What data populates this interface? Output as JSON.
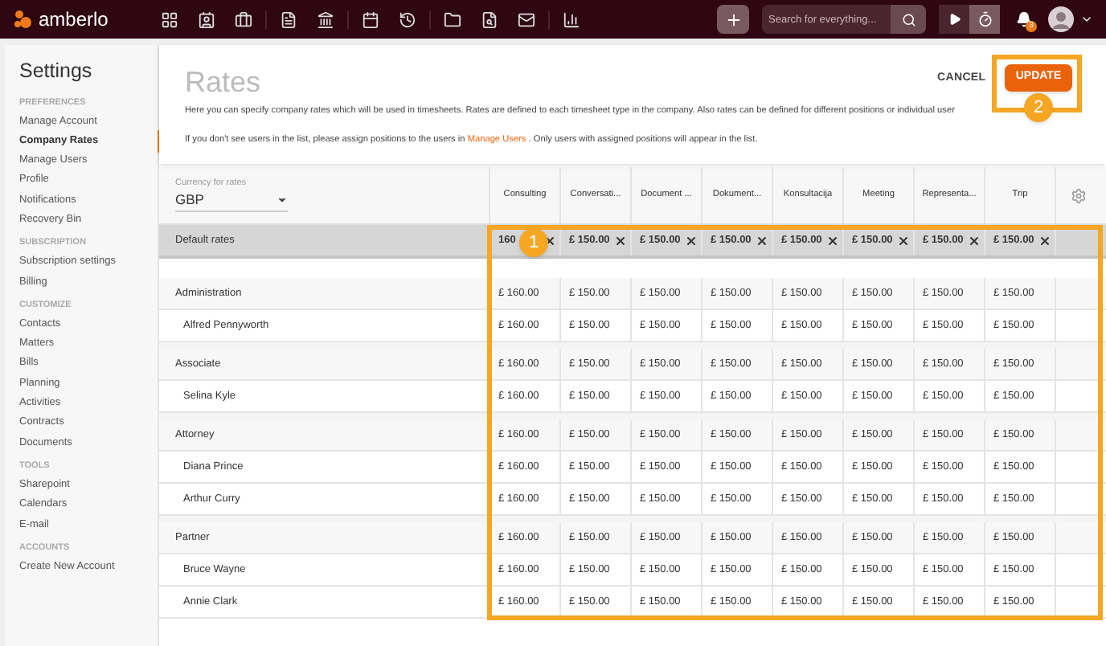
{
  "topbar": {
    "logo": "amberlo",
    "search": {
      "placeholder": "Search for everything..."
    },
    "notification_count": "3"
  },
  "sidebar": {
    "title": "Settings",
    "sections": [
      {
        "heading": "PREFERENCES",
        "items": [
          {
            "label": "Manage Account",
            "selected": false
          },
          {
            "label": "Company Rates",
            "selected": true
          },
          {
            "label": "Manage Users",
            "selected": false
          },
          {
            "label": "Profile",
            "selected": false
          },
          {
            "label": "Notifications",
            "selected": false
          },
          {
            "label": "Recovery Bin",
            "selected": false
          }
        ]
      },
      {
        "heading": "SUBSCRIPTION",
        "items": [
          {
            "label": "Subscription settings",
            "selected": false
          },
          {
            "label": "Billing",
            "selected": false
          }
        ]
      },
      {
        "heading": "CUSTOMIZE",
        "items": [
          {
            "label": "Contacts",
            "selected": false
          },
          {
            "label": "Matters",
            "selected": false
          },
          {
            "label": "Bills",
            "selected": false
          },
          {
            "label": "Planning",
            "selected": false
          },
          {
            "label": "Activities",
            "selected": false
          },
          {
            "label": "Contracts",
            "selected": false
          },
          {
            "label": "Documents",
            "selected": false
          }
        ]
      },
      {
        "heading": "TOOLS",
        "items": [
          {
            "label": "Sharepoint",
            "selected": false
          },
          {
            "label": "Calendars",
            "selected": false
          },
          {
            "label": "E-mail",
            "selected": false
          }
        ]
      },
      {
        "heading": "ACCOUNTS",
        "items": [
          {
            "label": "Create New Account",
            "selected": false
          }
        ]
      }
    ]
  },
  "rates": {
    "title": "Rates",
    "description": "Here you can specify company rates which will be used in timesheets. Rates are defined to each timesheet type in the company. Also rates can be defined for different positions or individual user",
    "note_before": "If you don't see users in the list, please assign positions to the users in",
    "note_link": "Manage Users",
    "note_after": ". Only users with assigned positions will appear in the list.",
    "cancel": "CANCEL",
    "update": "UPDATE",
    "currency_label": "Currency for rates",
    "currency": "GBP",
    "columns": [
      "Consulting",
      "Conversati...",
      "Document ...",
      "Dokument...",
      "Konsultacija",
      "Meeting",
      "Representa...",
      "Trip"
    ],
    "default_rates": {
      "label": "Default rates",
      "values": [
        "160",
        "£ 150.00",
        "£ 150.00",
        "£ 150.00",
        "£ 150.00",
        "£ 150.00",
        "£ 150.00",
        "£ 150.00"
      ]
    },
    "groups": [
      {
        "name": "Administration",
        "values": [
          "£ 160.00",
          "£ 150.00",
          "£ 150.00",
          "£ 150.00",
          "£ 150.00",
          "£ 150.00",
          "£ 150.00",
          "£ 150.00"
        ],
        "members": [
          {
            "name": "Alfred Pennyworth",
            "values": [
              "£ 160.00",
              "£ 150.00",
              "£ 150.00",
              "£ 150.00",
              "£ 150.00",
              "£ 150.00",
              "£ 150.00",
              "£ 150.00"
            ]
          }
        ]
      },
      {
        "name": "Associate",
        "values": [
          "£ 160.00",
          "£ 150.00",
          "£ 150.00",
          "£ 150.00",
          "£ 150.00",
          "£ 150.00",
          "£ 150.00",
          "£ 150.00"
        ],
        "members": [
          {
            "name": "Selina Kyle",
            "values": [
              "£ 160.00",
              "£ 150.00",
              "£ 150.00",
              "£ 150.00",
              "£ 150.00",
              "£ 150.00",
              "£ 150.00",
              "£ 150.00"
            ]
          }
        ]
      },
      {
        "name": "Attorney",
        "values": [
          "£ 160.00",
          "£ 150.00",
          "£ 150.00",
          "£ 150.00",
          "£ 150.00",
          "£ 150.00",
          "£ 150.00",
          "£ 150.00"
        ],
        "members": [
          {
            "name": "Diana Prince",
            "values": [
              "£ 160.00",
              "£ 150.00",
              "£ 150.00",
              "£ 150.00",
              "£ 150.00",
              "£ 150.00",
              "£ 150.00",
              "£ 150.00"
            ]
          },
          {
            "name": "Arthur Curry",
            "values": [
              "£ 160.00",
              "£ 150.00",
              "£ 150.00",
              "£ 150.00",
              "£ 150.00",
              "£ 150.00",
              "£ 150.00",
              "£ 150.00"
            ]
          }
        ]
      },
      {
        "name": "Partner",
        "values": [
          "£ 160.00",
          "£ 150.00",
          "£ 150.00",
          "£ 150.00",
          "£ 150.00",
          "£ 150.00",
          "£ 150.00",
          "£ 150.00"
        ],
        "members": [
          {
            "name": "Bruce Wayne",
            "values": [
              "£ 160.00",
              "£ 150.00",
              "£ 150.00",
              "£ 150.00",
              "£ 150.00",
              "£ 150.00",
              "£ 150.00",
              "£ 150.00"
            ]
          },
          {
            "name": "Annie Clark",
            "values": [
              "£ 160.00",
              "£ 150.00",
              "£ 150.00",
              "£ 150.00",
              "£ 150.00",
              "£ 150.00",
              "£ 150.00",
              "£ 150.00"
            ]
          }
        ]
      }
    ]
  },
  "callouts": [
    {
      "number": "1"
    },
    {
      "number": "2"
    }
  ]
}
